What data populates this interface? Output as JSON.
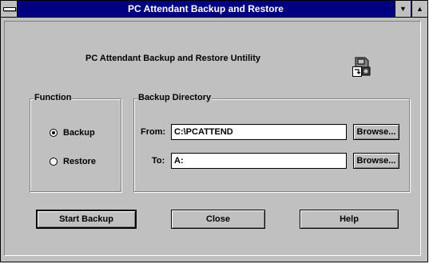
{
  "window": {
    "title": "PC Attendant Backup and Restore"
  },
  "heading": "PC Attendant Backup and Restore Untility",
  "function_group": {
    "label": "Function",
    "options": [
      {
        "label": "Backup",
        "selected": true
      },
      {
        "label": "Restore",
        "selected": false
      }
    ]
  },
  "directory_group": {
    "label": "Backup Directory",
    "from_label": "From:",
    "from_value": "C:\\PCATTEND",
    "to_label": "To:",
    "to_value": "A:",
    "browse_label": "Browse..."
  },
  "buttons": {
    "start": "Start Backup",
    "close": "Close",
    "help": "Help"
  },
  "icons": {
    "system_menu": "system-menu-icon",
    "minimize": "minimize-icon",
    "maximize": "maximize-icon",
    "app": "backup-restore-icon"
  },
  "colors": {
    "titlebar": "#000080",
    "face": "#c0c0c0"
  }
}
